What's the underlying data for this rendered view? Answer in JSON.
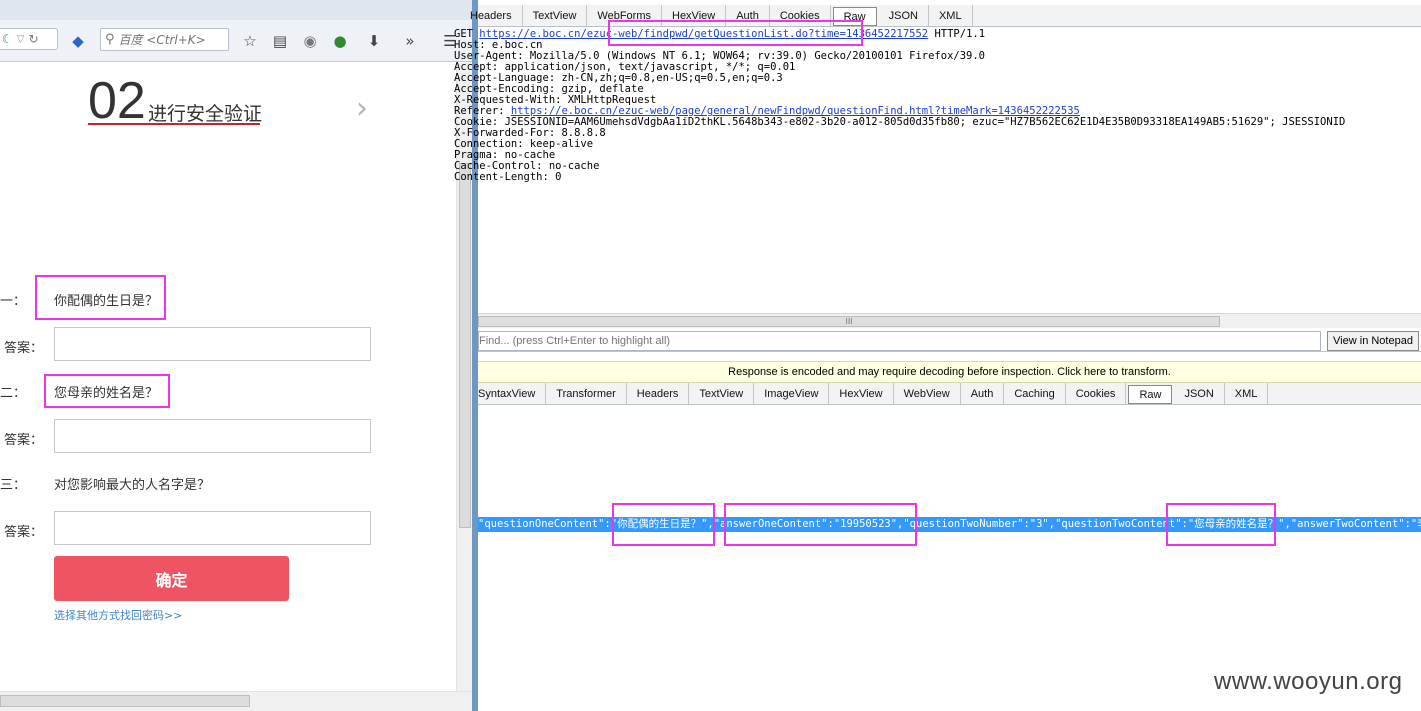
{
  "browser": {
    "search_placeholder": "百度 <Ctrl+K>",
    "step_number": "02",
    "step_title": "进行安全验证",
    "next_arrow": "›",
    "questions": [
      {
        "label": "问题一：",
        "text": "你配偶的生日是？",
        "answer_label": "答案："
      },
      {
        "label": "问题二：",
        "text": "您母亲的姓名是？",
        "answer_label": "答案："
      },
      {
        "label": "问题三：",
        "text": "对您影响最大的人名字是？",
        "answer_label": "答案："
      }
    ],
    "confirm_label": "确定",
    "other_link": "选择其他方式找回密码>>",
    "icons": [
      "reload-icon",
      "search-icon",
      "bookmark-star-icon",
      "reading-list-icon",
      "addon-icon",
      "download-icon",
      "overflow-icon",
      "menu-icon"
    ]
  },
  "fiddler": {
    "request_tabs": [
      "Headers",
      "TextView",
      "WebForms",
      "HexView",
      "Auth",
      "Cookies",
      "Raw",
      "JSON",
      "XML"
    ],
    "request_active_tab": "Raw",
    "request_lines": {
      "l1_pre": "GET ",
      "l1_url": "https://e.boc.cn/ezuc-web/findpwd/getQuestionList.do?time=1436452217552",
      "l1_post": " HTTP/1.1",
      "l2": "Host: e.boc.cn",
      "l3": "User-Agent: Mozilla/5.0 (Windows NT 6.1; WOW64; rv:39.0) Gecko/20100101 Firefox/39.0",
      "l4": "Accept: application/json, text/javascript, */*; q=0.01",
      "l5": "Accept-Language: zh-CN,zh;q=0.8,en-US;q=0.5,en;q=0.3",
      "l6": "Accept-Encoding: gzip, deflate",
      "l7": "X-Requested-With: XMLHttpRequest",
      "l8_pre": "Referer: ",
      "l8_url": "https://e.boc.cn/ezuc-web/page/general/newFindpwd/questionFind.html?timeMark=1436452222535",
      "l9": "Cookie: JSESSIONID=AAM6UmehsdVdgbAa1iD2thKL.5648b343-e802-3b20-a012-805d0d35fb80; ezuc=\"HZ7B562EC62E1D4E35B0D93318EA149AB5:51629\"; JSESSIONID",
      "l10": "X-Forwarded-For: 8.8.8.8",
      "l11": "Connection: keep-alive",
      "l12": "Pragma: no-cache",
      "l13": "Cache-Control: no-cache",
      "l14": "Content-Length: 0"
    },
    "find_placeholder": "Find... (press Ctrl+Enter to highlight all)",
    "notepad_label": "View in Notepad",
    "encoded_notice": "Response is encoded and may require decoding before inspection. Click here to transform.",
    "response_tabs": [
      "Transformer",
      "Headers",
      "TextView",
      "ImageView",
      "HexView",
      "WebView",
      "Auth",
      "Caching",
      "Cookies",
      "Raw",
      "JSON",
      "XML"
    ],
    "response_first_tab": "SyntaxView",
    "response_active_tab": "Raw",
    "response_line": "\"questionOneContent\":\"你配偶的生日是？\",\"answerOneContent\":\"19950523\",\"questionTwoNumber\":\"3\",\"questionTwoContent\":\"您母亲的姓名是？\",\"answerTwoContent\":\"李",
    "scroll_grip": "III"
  },
  "watermark": "www.wooyun.org"
}
